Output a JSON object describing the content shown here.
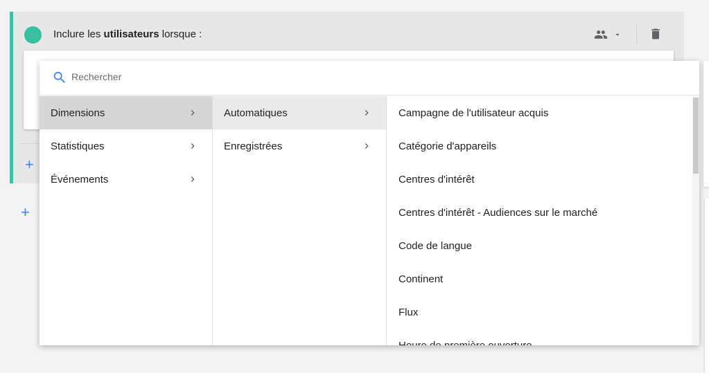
{
  "condition": {
    "prefix": "Inclure les ",
    "bold": "utilisateurs",
    "suffix": " lorsque :",
    "people_icon": "people-icon",
    "dropdown_icon": "caret-down-icon",
    "delete_icon": "trash-icon",
    "accent_color": "#3cc1a6",
    "add_icon": "plus-icon"
  },
  "picker": {
    "search": {
      "placeholder": "Rechercher",
      "value": "",
      "icon": "search-icon"
    },
    "categories": [
      {
        "label": "Dimensions"
      },
      {
        "label": "Statistiques"
      },
      {
        "label": "Événements"
      }
    ],
    "subcategories": [
      {
        "label": "Automatiques"
      },
      {
        "label": "Enregistrées"
      }
    ],
    "fields": [
      {
        "label": "Campagne de l'utilisateur acquis"
      },
      {
        "label": "Catégorie d'appareils"
      },
      {
        "label": "Centres d'intérêt"
      },
      {
        "label": "Centres d'intérêt - Audiences sur le marché"
      },
      {
        "label": "Code de langue"
      },
      {
        "label": "Continent"
      },
      {
        "label": "Flux"
      },
      {
        "label": "Heure de première ouverture"
      }
    ]
  }
}
